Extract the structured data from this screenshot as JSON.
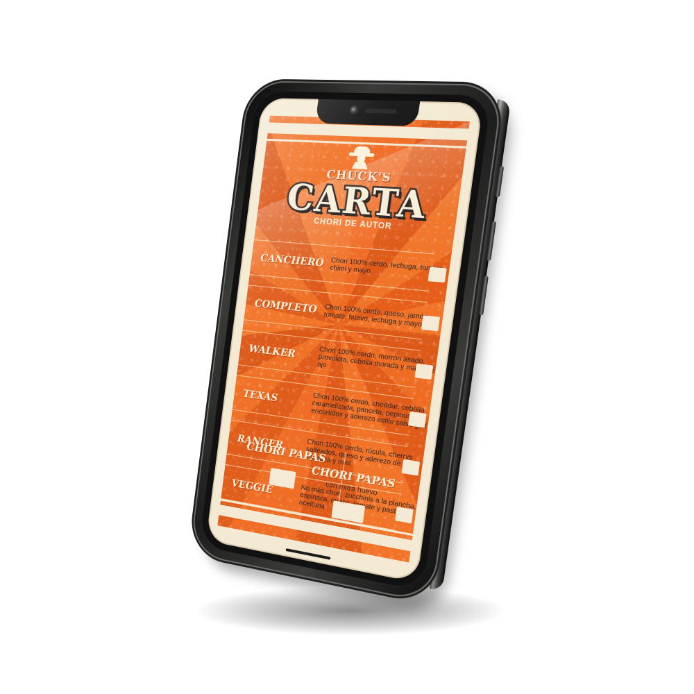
{
  "screen": {
    "brand": "CHUCK'S",
    "title": "CARTA",
    "subtitle": "CHORI DE AUTOR",
    "icon": "cowboy-logo-icon",
    "items": [
      {
        "name": "CANCHERO",
        "description": "Chori 100% cerdo, lechuga, tomate, chimi y mayo"
      },
      {
        "name": "COMPLETO",
        "description": "Chori 100% cerdo, queso, jamón, tomate, huevo, lechuga y mayo"
      },
      {
        "name": "WALKER",
        "description": "Chori 100% cerdo, morrón asado, provoleta, cebolla morada y mayo de ajo"
      },
      {
        "name": "TEXAS",
        "description": "Chori 100% cerdo, cheddar, cebolla caramelizada, panceta, pepinos encurtidos y aderezo estilo salsa golf"
      },
      {
        "name": "RANGER",
        "description": "Chori 100% cerdo, rúcula, cherrys salteados, queso y aderezo de mostaza y miel"
      },
      {
        "name": "VEGGIE",
        "description": "No más chori, zucchinis a la plancha, espinaca, queso, tomate y pasta de aceituna"
      }
    ],
    "footer": {
      "left_title": "CHORI PAPAS",
      "right_title": "CHORI PAPAS",
      "right_note": "con extra huevo"
    }
  },
  "colors": {
    "orange": "#ef6a22",
    "cream": "#f5ead6",
    "text_dark": "#2e2726",
    "phone_dark": "#151615"
  }
}
